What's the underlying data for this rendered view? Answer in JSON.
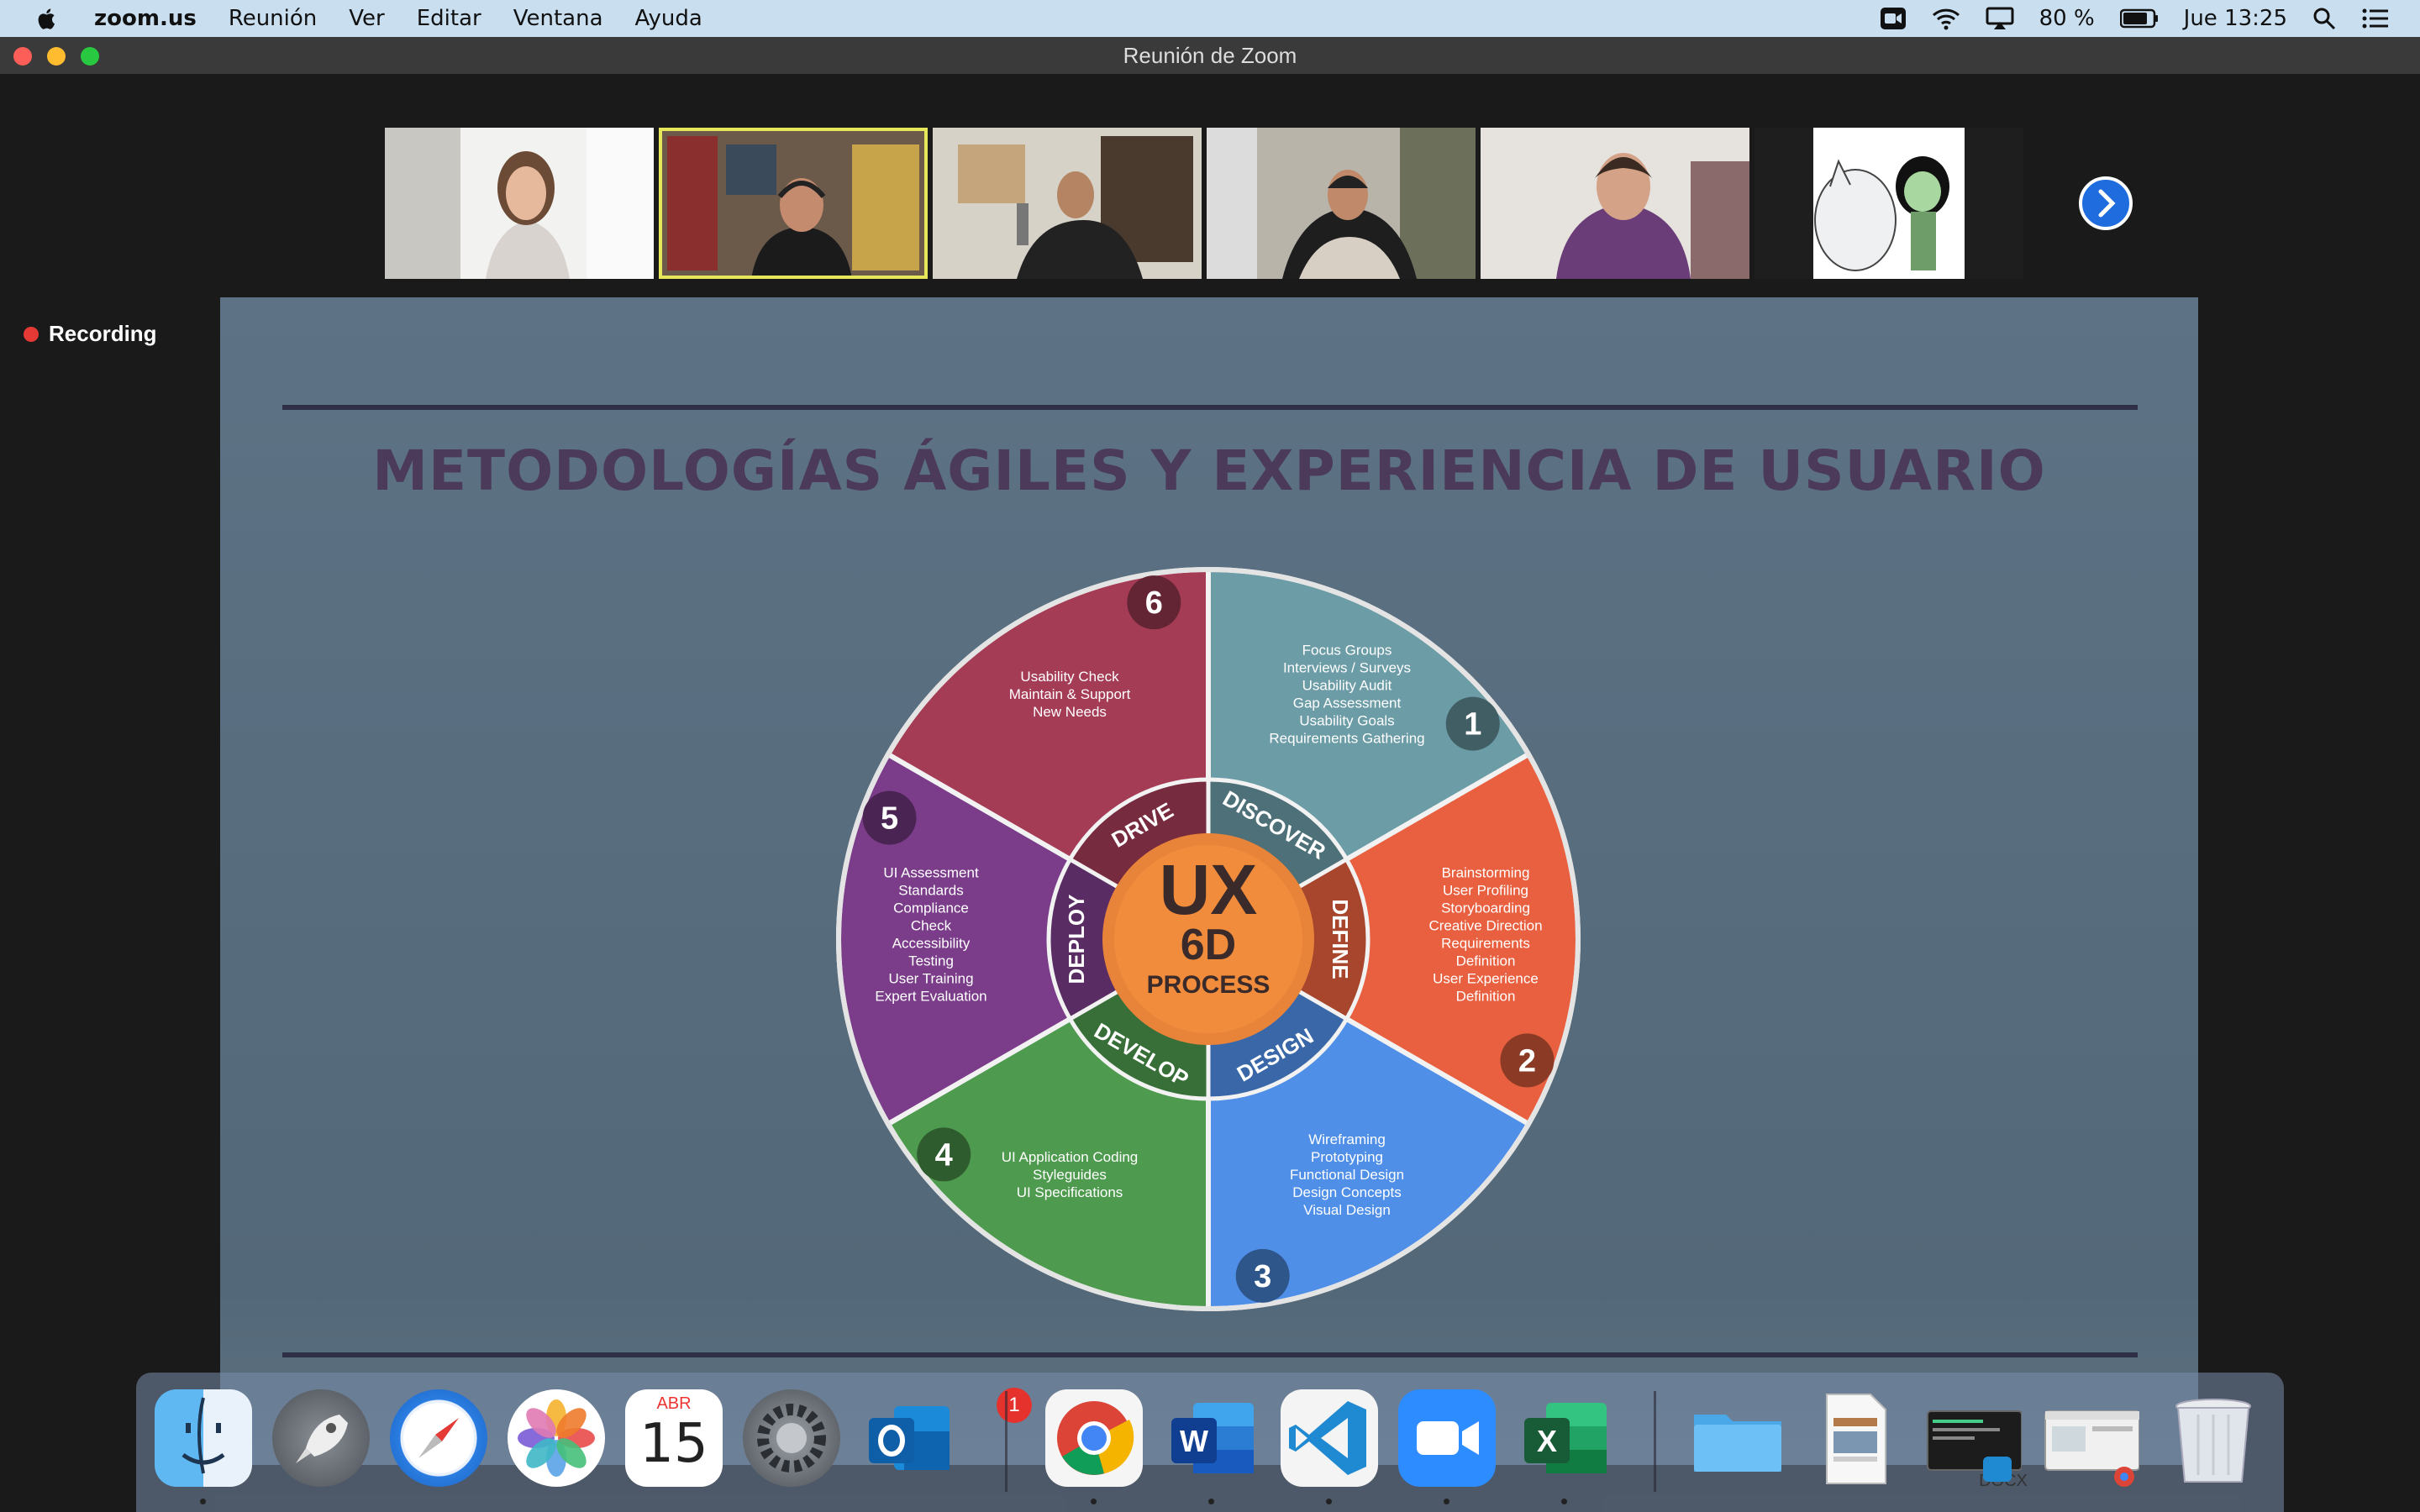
{
  "menubar": {
    "app_name": "zoom.us",
    "menus": [
      "Reunión",
      "Ver",
      "Editar",
      "Ventana",
      "Ayuda"
    ],
    "battery": "80 %",
    "clock": "Jue 13:25",
    "icons": [
      "apple-icon",
      "zoom-video-icon",
      "wifi-icon",
      "airplay-icon",
      "battery-icon",
      "spotlight-search-icon",
      "notification-center-icon"
    ]
  },
  "window": {
    "title": "Reunión de Zoom",
    "recording_label": "Recording"
  },
  "slide": {
    "title": "METODOLOGÍAS ÁGILES Y EXPERIENCIA DE USUARIO",
    "center": {
      "line1": "UX",
      "line2": "6D",
      "line3": "PROCESS"
    },
    "segments": [
      {
        "num": "1",
        "label": "DISCOVER",
        "color": "#6c9ca6",
        "items": [
          "Focus Groups",
          "Interviews / Surveys",
          "Usability Audit",
          "Gap Assessment",
          "Usability Goals",
          "Requirements Gathering"
        ]
      },
      {
        "num": "2",
        "label": "DEFINE",
        "color": "#e8603f",
        "items": [
          "Brainstorming",
          "User Profiling",
          "Storyboarding",
          "Creative Direction",
          "Requirements",
          "Definition",
          "User Experience",
          "Definition"
        ]
      },
      {
        "num": "3",
        "label": "DESIGN",
        "color": "#4f8fe8",
        "items": [
          "Wireframing",
          "Prototyping",
          "Functional Design",
          "Design Concepts",
          "Visual Design"
        ]
      },
      {
        "num": "4",
        "label": "DEVELOP",
        "color": "#4e9a4e",
        "items": [
          "UI Application Coding",
          "Styleguides",
          "UI Specifications"
        ]
      },
      {
        "num": "5",
        "label": "DEPLOY",
        "color": "#7b3d8a",
        "items": [
          "UI Assessment",
          "Standards",
          "Compliance",
          "Check",
          "Accessibility",
          "Testing",
          "User Training",
          "Expert Evaluation"
        ]
      },
      {
        "num": "6",
        "label": "DRIVE",
        "color": "#a53c56",
        "items": [
          "Usability Check",
          "Maintain & Support",
          "New Needs"
        ]
      }
    ]
  },
  "dock": {
    "calendar_month": "ABR",
    "calendar_day": "15",
    "settings_badge": "1",
    "docx_label": "DOCX",
    "apps": [
      "Finder",
      "Launchpad",
      "Safari",
      "Fotos",
      "Calendario",
      "Preferencias del Sistema",
      "Outlook",
      "Chrome",
      "Word",
      "Visual Studio Code",
      "Zoom",
      "Excel",
      "Carpeta",
      "Documento",
      "Terminal",
      "Chrome ventana",
      "Papelera"
    ]
  }
}
